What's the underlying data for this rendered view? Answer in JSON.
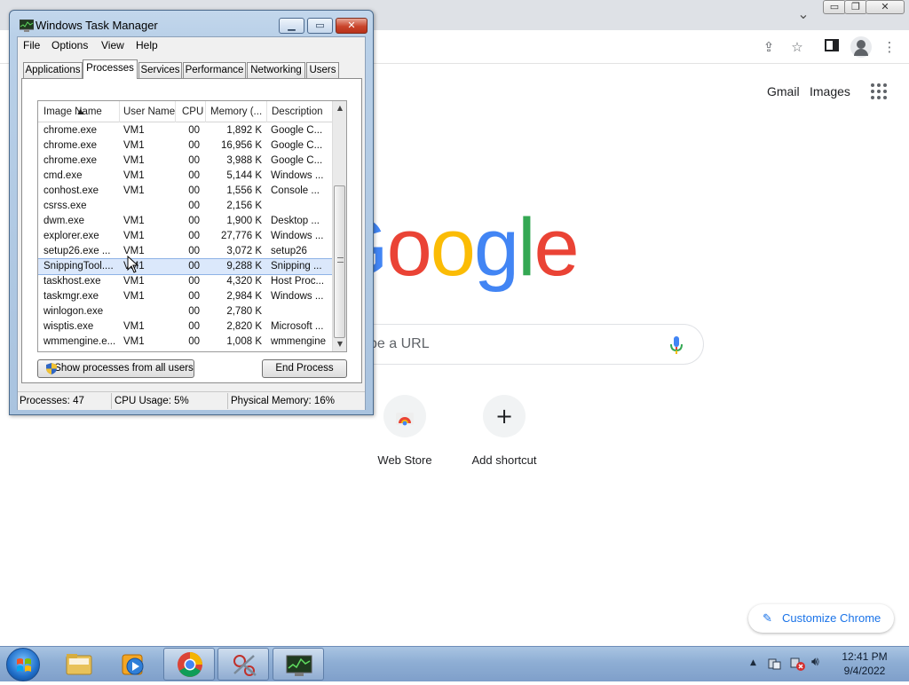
{
  "chrome": {
    "window_controls": {
      "minimize": "▭",
      "restore": "❐",
      "close": "✕"
    },
    "header_links": {
      "gmail": "Gmail",
      "images": "Images"
    },
    "search": {
      "placeholder": "pe a URL"
    },
    "shortcuts": [
      {
        "label": "Web Store"
      },
      {
        "label": "Add shortcut",
        "glyph": "+"
      }
    ],
    "customize": "Customize Chrome",
    "logo_colors": [
      "#4285f4",
      "#ea4335",
      "#fbbc05",
      "#4285f4",
      "#34a853",
      "#ea4335"
    ]
  },
  "taskmgr": {
    "title": "Windows Task Manager",
    "menu": [
      "File",
      "Options",
      "View",
      "Help"
    ],
    "tabs": [
      "Applications",
      "Processes",
      "Services",
      "Performance",
      "Networking",
      "Users"
    ],
    "active_tab": "Processes",
    "columns": [
      "Image Name",
      "User Name",
      "CPU",
      "Memory (...",
      "Description"
    ],
    "processes": [
      {
        "name": "chrome.exe",
        "user": "VM1",
        "cpu": "00",
        "mem": "1,892 K",
        "desc": "Google C..."
      },
      {
        "name": "chrome.exe",
        "user": "VM1",
        "cpu": "00",
        "mem": "16,956 K",
        "desc": "Google C..."
      },
      {
        "name": "chrome.exe",
        "user": "VM1",
        "cpu": "00",
        "mem": "3,988 K",
        "desc": "Google C..."
      },
      {
        "name": "cmd.exe",
        "user": "VM1",
        "cpu": "00",
        "mem": "5,144 K",
        "desc": "Windows ..."
      },
      {
        "name": "conhost.exe",
        "user": "VM1",
        "cpu": "00",
        "mem": "1,556 K",
        "desc": "Console ..."
      },
      {
        "name": "csrss.exe",
        "user": "",
        "cpu": "00",
        "mem": "2,156 K",
        "desc": ""
      },
      {
        "name": "dwm.exe",
        "user": "VM1",
        "cpu": "00",
        "mem": "1,900 K",
        "desc": "Desktop ..."
      },
      {
        "name": "explorer.exe",
        "user": "VM1",
        "cpu": "00",
        "mem": "27,776 K",
        "desc": "Windows ..."
      },
      {
        "name": "setup26.exe ...",
        "user": "VM1",
        "cpu": "00",
        "mem": "3,072 K",
        "desc": "setup26"
      },
      {
        "name": "SnippingTool....",
        "user": "VM1",
        "cpu": "00",
        "mem": "9,288 K",
        "desc": "Snipping ...",
        "selected": true
      },
      {
        "name": "taskhost.exe",
        "user": "VM1",
        "cpu": "00",
        "mem": "4,320 K",
        "desc": "Host Proc..."
      },
      {
        "name": "taskmgr.exe",
        "user": "VM1",
        "cpu": "00",
        "mem": "2,984 K",
        "desc": "Windows ..."
      },
      {
        "name": "winlogon.exe",
        "user": "",
        "cpu": "00",
        "mem": "2,780 K",
        "desc": ""
      },
      {
        "name": "wisptis.exe",
        "user": "VM1",
        "cpu": "00",
        "mem": "2,820 K",
        "desc": "Microsoft ..."
      },
      {
        "name": "wmmengine.e...",
        "user": "VM1",
        "cpu": "00",
        "mem": "1,008 K",
        "desc": "wmmengine"
      }
    ],
    "show_all_button": "Show processes from all users",
    "end_process_button": "End Process",
    "status": {
      "processes": "Processes: 47",
      "cpu": "CPU Usage: 5%",
      "memory": "Physical Memory: 16%"
    }
  },
  "taskbar": {
    "clock_time": "12:41 PM",
    "clock_date": "9/4/2022"
  }
}
